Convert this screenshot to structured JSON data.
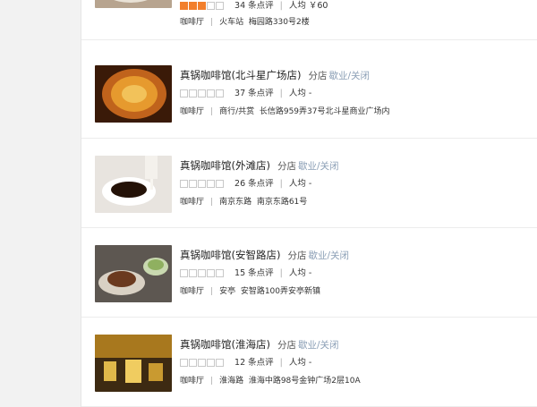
{
  "shops": [
    {
      "name": "",
      "branch_tag": "",
      "status": "",
      "stars": 3,
      "review_count": "34 条点评",
      "avg_price": "人均 ￥60",
      "category": "咖啡厅",
      "district": "火车站",
      "address": "梅园路330号2楼"
    },
    {
      "name": "真锅咖啡馆(北斗星广场店)",
      "branch_tag": "分店",
      "status": "歇业/关闭",
      "stars": 0,
      "review_count": "37 条点评",
      "avg_price": "人均 -",
      "category": "咖啡厅",
      "district": "商行/共赏",
      "address": "长信路959弄37号北斗星商业广场内"
    },
    {
      "name": "真锅咖啡馆(外滩店)",
      "branch_tag": "分店",
      "status": "歇业/关闭",
      "stars": 0,
      "review_count": "26 条点评",
      "avg_price": "人均 -",
      "category": "咖啡厅",
      "district": "南京东路",
      "address": "南京东路61号"
    },
    {
      "name": "真锅咖啡馆(安智路店)",
      "branch_tag": "分店",
      "status": "歇业/关闭",
      "stars": 0,
      "review_count": "15 条点评",
      "avg_price": "人均 -",
      "category": "咖啡厅",
      "district": "安亭",
      "address": "安智路100弄安亭新镇"
    },
    {
      "name": "真锅咖啡馆(淮海店)",
      "branch_tag": "分店",
      "status": "歇业/关闭",
      "stars": 0,
      "review_count": "12 条点评",
      "avg_price": "人均 -",
      "category": "咖啡厅",
      "district": "淮海路",
      "address": "淮海中路98号金钟广场2层10A"
    }
  ],
  "colors": {
    "star_on": "#f27f2c",
    "star_off": "#c8c8c8",
    "status": "#8a9eb5"
  }
}
